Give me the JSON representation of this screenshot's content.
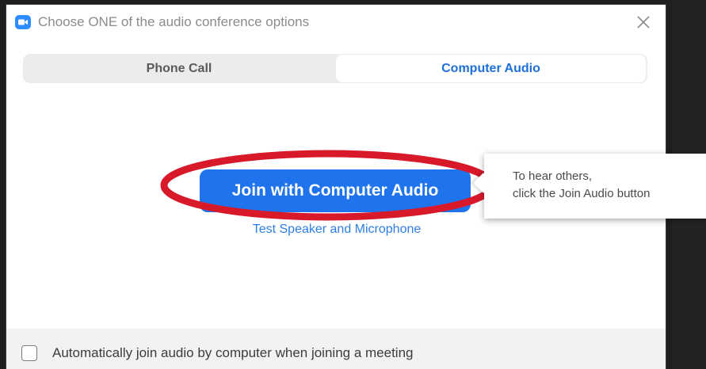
{
  "window": {
    "title": "Choose ONE of the audio conference options",
    "app_icon": "zoom-camera-icon",
    "close_icon": "close-icon"
  },
  "tabs": [
    {
      "label": "Phone Call",
      "selected": false
    },
    {
      "label": "Computer Audio",
      "selected": true
    }
  ],
  "main": {
    "join_button_label": "Join with Computer Audio",
    "test_link_label": "Test Speaker and Microphone"
  },
  "tooltip": {
    "line1": "To hear others,",
    "line2": "click the Join Audio button"
  },
  "footer": {
    "checkbox_label": "Automatically join audio by computer when joining a meeting",
    "checked": false
  },
  "colors": {
    "accent": "#1f74ee",
    "annotation_ring": "#d7192a",
    "link": "#2d7fe6"
  }
}
